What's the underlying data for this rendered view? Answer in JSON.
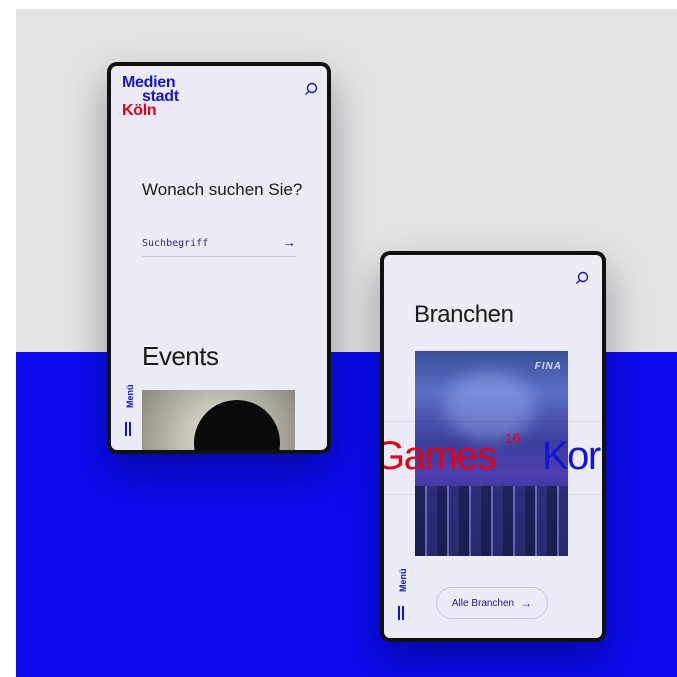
{
  "brand": {
    "logo_line1": "Medien",
    "logo_line2": "stadt",
    "logo_line3": "Köln",
    "primary_color": "#1414d8",
    "accent_color": "#e3001b"
  },
  "search": {
    "heading": "Wonach suchen Sie?",
    "placeholder": "Suchbegriff",
    "submit_icon": "arrow-right-icon"
  },
  "events": {
    "heading": "Events"
  },
  "menu": {
    "label": "Menü"
  },
  "branchen": {
    "heading": "Branchen",
    "image_caption": "FINA",
    "current_label": "Games",
    "current_count": "16",
    "next_label": "Kor",
    "button_label": "Alle Branchen",
    "button_icon": "arrow-right-icon"
  },
  "icons": {
    "search": "search-icon",
    "menu": "menu-bars-icon"
  },
  "background": {
    "top_color": "#e3e3e3",
    "bottom_color": "#0b0bee"
  }
}
